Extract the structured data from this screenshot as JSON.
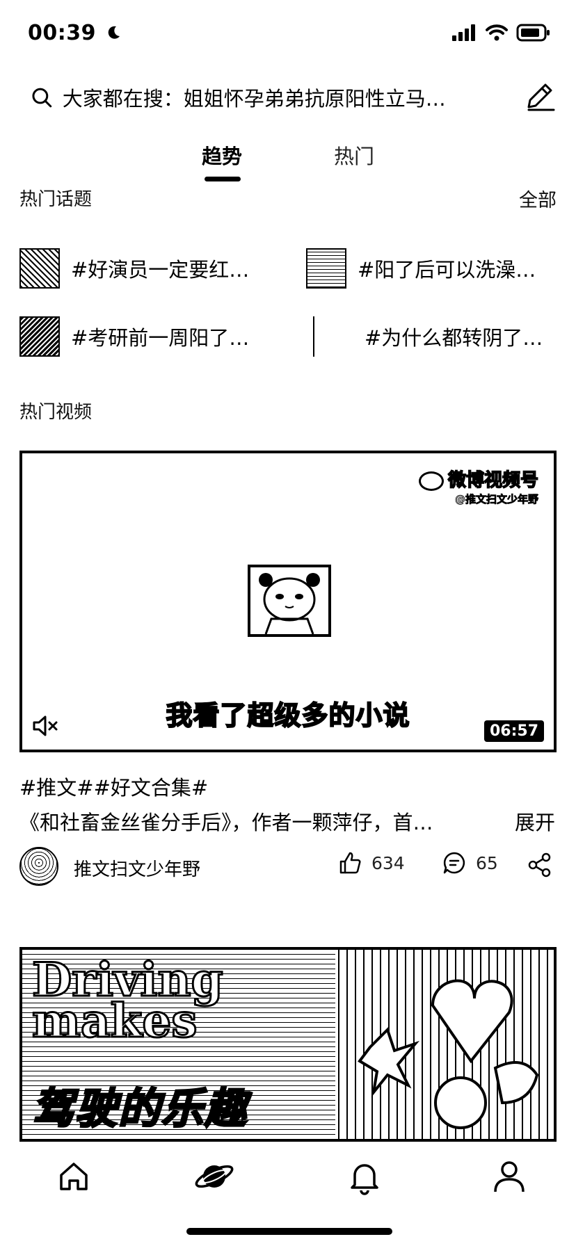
{
  "status_bar": {
    "time": "00:39"
  },
  "search": {
    "text": "大家都在搜：姐姐怀孕弟弟抗原阳性立马…"
  },
  "tabs": [
    {
      "label": "趋势",
      "active": true
    },
    {
      "label": "热门",
      "active": false
    }
  ],
  "hot_topics": {
    "title": "热门话题",
    "see_all": "全部",
    "items": [
      {
        "label": "#好演员一定要红…"
      },
      {
        "label": "#阳了后可以洗澡…"
      },
      {
        "label": "#考研前一周阳了…"
      },
      {
        "label": "#为什么都转阴了…"
      }
    ]
  },
  "hot_videos": {
    "title": "热门视频",
    "video1": {
      "watermark_main": "微博视频号",
      "watermark_sub": "@推文扫文少年野",
      "subtitle": "我看了超级多的小说",
      "duration": "06:57",
      "tags": "#推文##好文合集#",
      "description": "《和社畜金丝雀分手后》，作者一颗萍仔，首…",
      "expand_label": "展开",
      "author": "推文扫文少年野",
      "likes": "634",
      "comments": "65"
    },
    "video2": {
      "title_line1": "Driving",
      "title_line2": "makes",
      "cn_text": "驾驶的乐趣"
    }
  },
  "tab_bar": [
    {
      "icon": "home-icon"
    },
    {
      "icon": "planet-icon",
      "active": true
    },
    {
      "icon": "bell-icon"
    },
    {
      "icon": "person-icon"
    }
  ]
}
